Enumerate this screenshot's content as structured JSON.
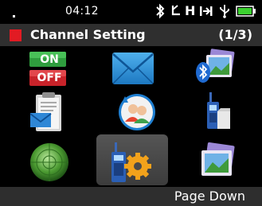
{
  "status_bar": {
    "time": "04:12",
    "indicator_letter": "H",
    "icons": [
      "bluetooth-icon",
      "gps-icon",
      "h-indicator-icon",
      "next-track-icon",
      "usb-icon",
      "battery-icon"
    ]
  },
  "title_bar": {
    "title": "Channel Setting",
    "page_indicator": "(1/3)",
    "accent_color": "#e21b23"
  },
  "grid": {
    "items": [
      {
        "name": "on-off-toggle",
        "on_label": "ON",
        "off_label": "OFF"
      },
      {
        "name": "messages"
      },
      {
        "name": "bluetooth-gallery"
      },
      {
        "name": "message-clipboard"
      },
      {
        "name": "contacts-sync"
      },
      {
        "name": "radio-device"
      },
      {
        "name": "radar"
      },
      {
        "name": "radio-settings",
        "selected": true
      },
      {
        "name": "gallery"
      }
    ]
  },
  "softkeys": {
    "right_label": "Page Down"
  }
}
